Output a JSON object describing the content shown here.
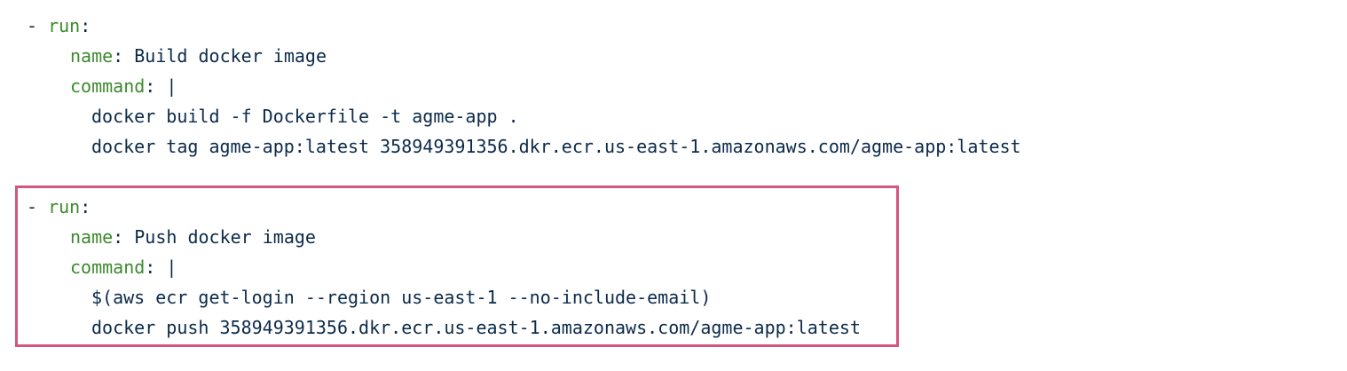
{
  "snippet": {
    "step1": {
      "dash": "- ",
      "run_key": "run",
      "colon": ":",
      "name_key": "name",
      "name_sep": ": ",
      "name_value": "Build docker image",
      "command_key": "command",
      "command_sep": ": |",
      "commands": [
        "docker build -f Dockerfile -t agme-app .",
        "docker tag agme-app:latest 358949391356.dkr.ecr.us-east-1.amazonaws.com/agme-app:latest"
      ]
    },
    "step2": {
      "dash": "- ",
      "run_key": "run",
      "colon": ":",
      "name_key": "name",
      "name_sep": ": ",
      "name_value": "Push docker image",
      "command_key": "command",
      "command_sep": ": |",
      "commands": [
        "$(aws ecr get-login --region us-east-1 --no-include-email)",
        "docker push 358949391356.dkr.ecr.us-east-1.amazonaws.com/agme-app:latest"
      ]
    }
  },
  "colors": {
    "key": "#3b8a2d",
    "text": "#0b2a4a",
    "highlight_border": "#d4567e"
  }
}
